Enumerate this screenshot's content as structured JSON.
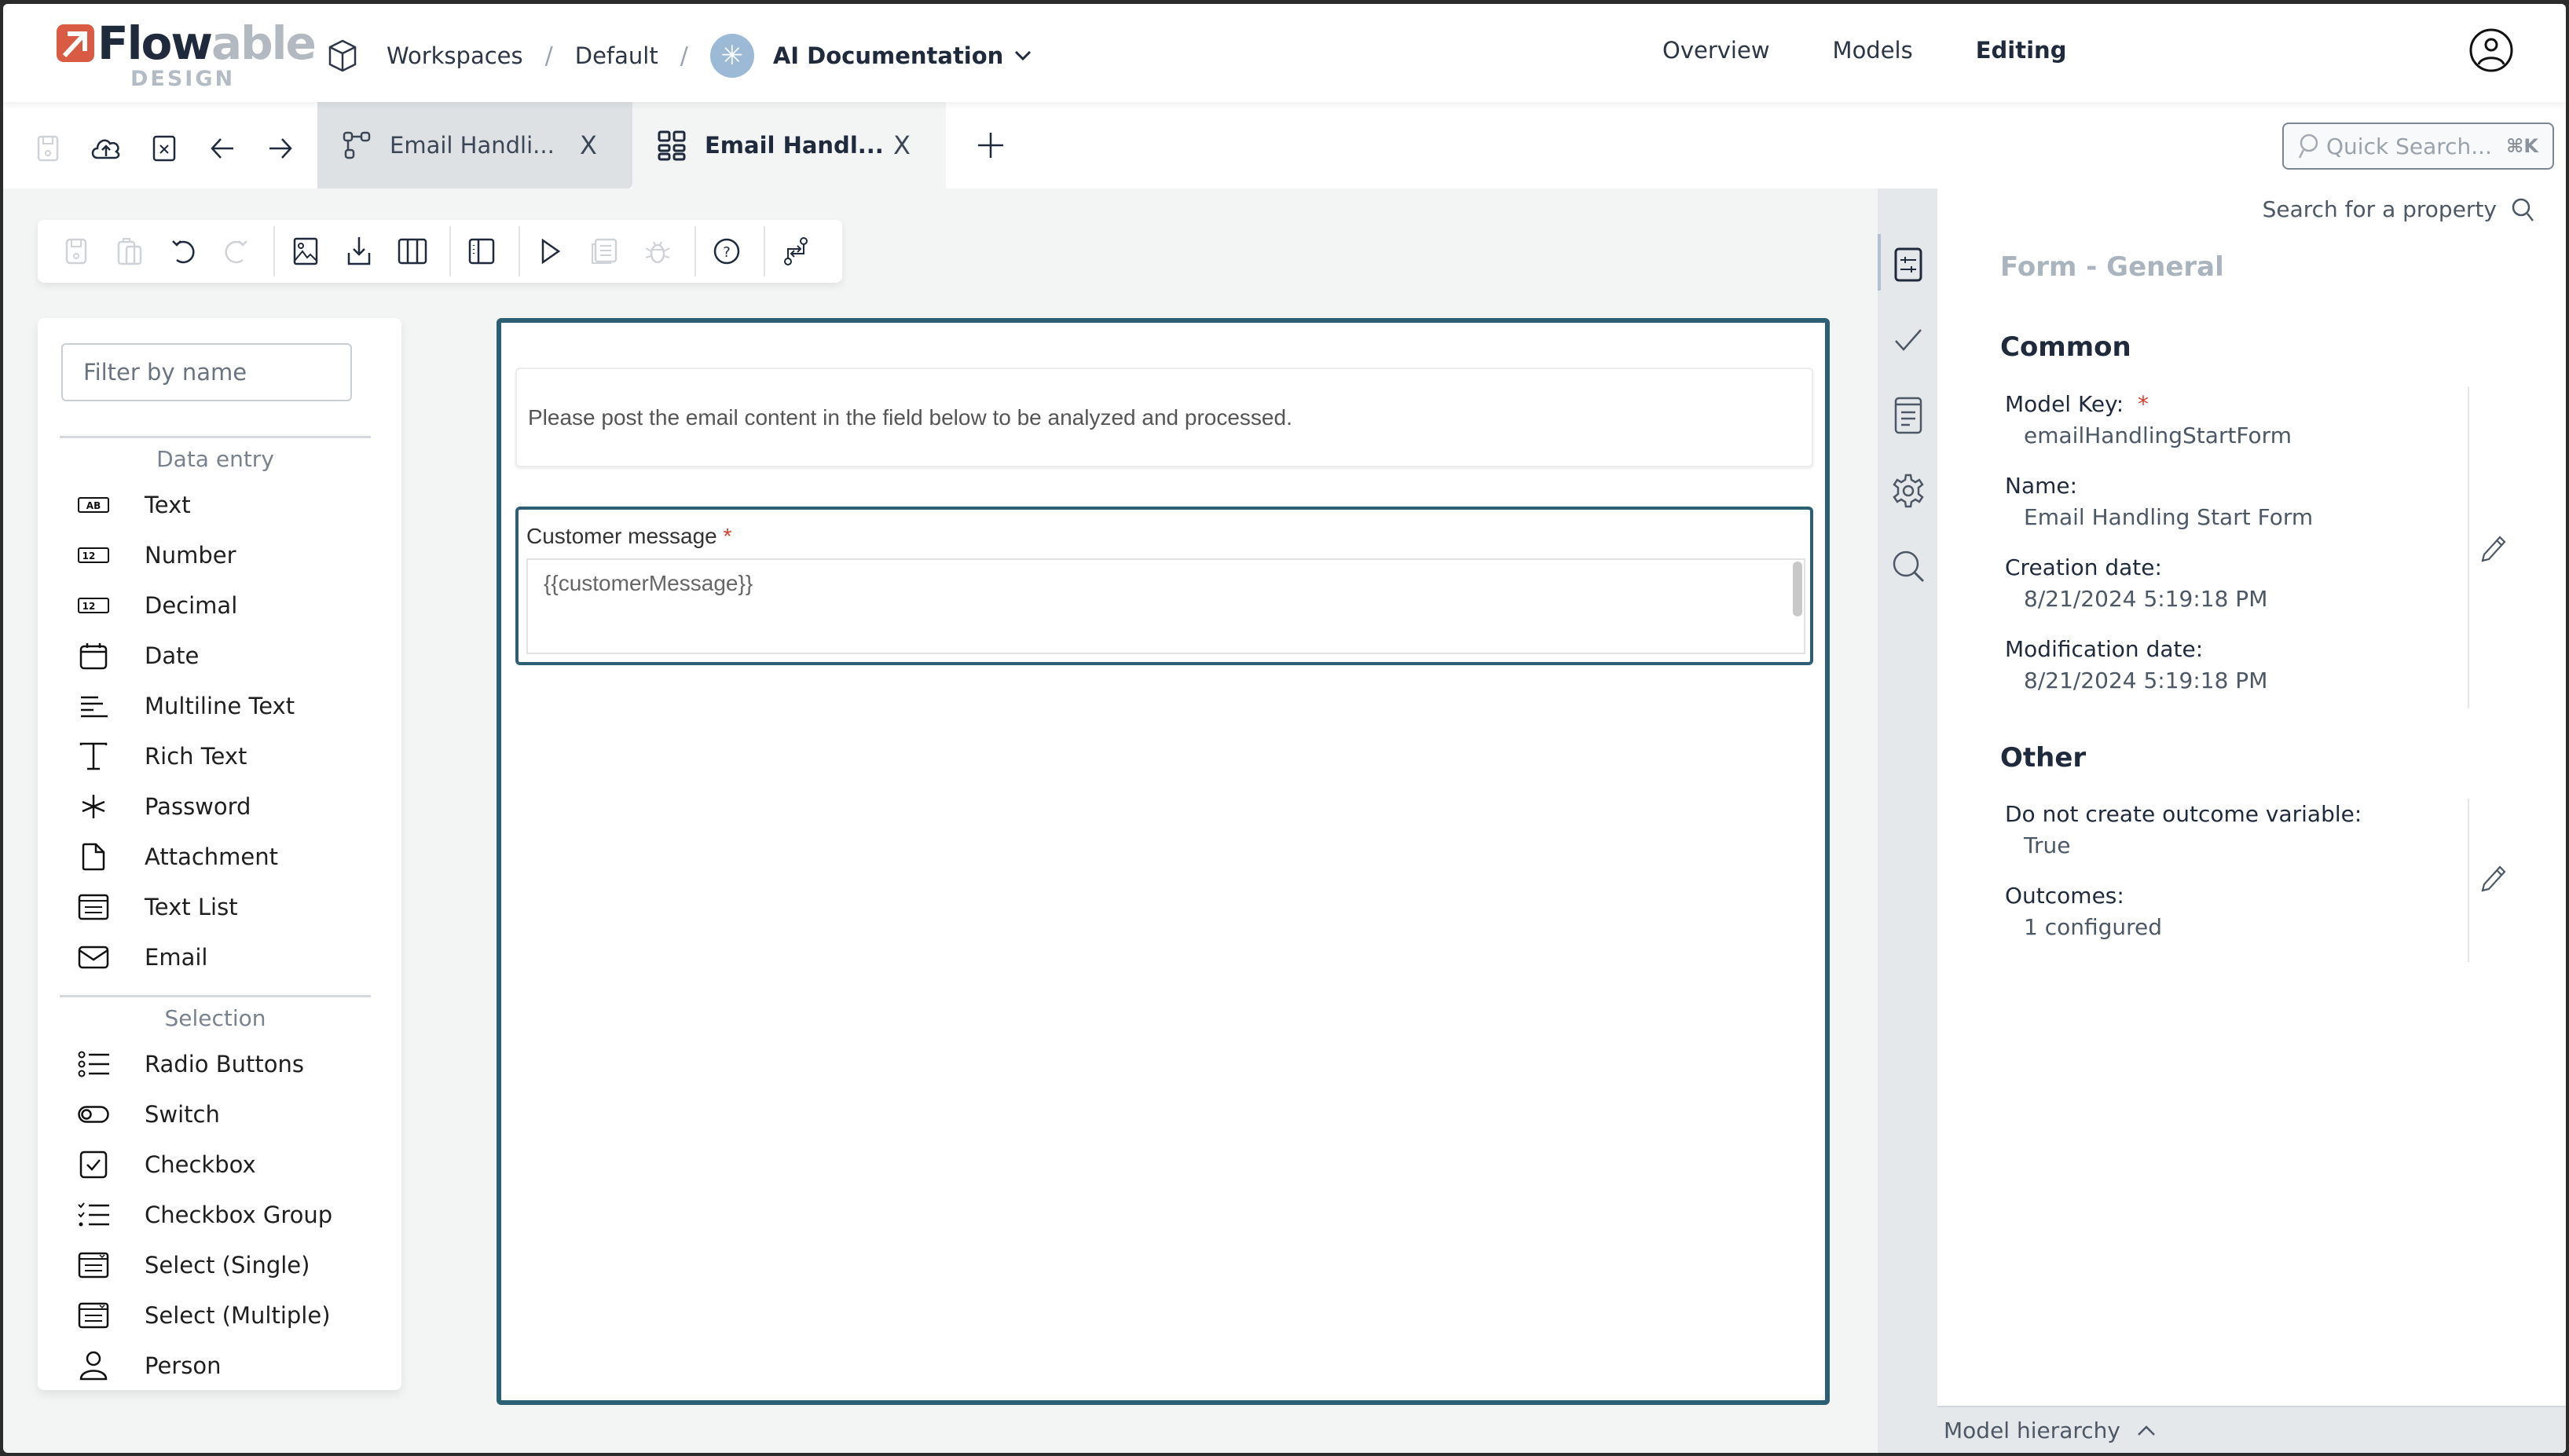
{
  "header": {
    "logo": {
      "brand_dark": "Flow",
      "brand_light": "able",
      "sub": "DESIGN"
    },
    "breadcrumb": [
      {
        "label": "Workspaces",
        "icon": "cube-icon"
      },
      {
        "label": "Default"
      },
      {
        "label": "AI Documentation",
        "icon": "asterisk-icon",
        "dropdown": true
      }
    ],
    "separator": "/",
    "nav": [
      {
        "label": "Overview",
        "active": false
      },
      {
        "label": "Models",
        "active": false
      },
      {
        "label": "Editing",
        "active": true
      }
    ],
    "user_icon": "user-circle-icon"
  },
  "tabbar": {
    "tools": [
      "save-icon",
      "upload-cloud-icon",
      "close-all-icon",
      "arrow-left-icon",
      "arrow-right-icon"
    ],
    "tabs": [
      {
        "label": "Email Handli...",
        "icon": "process-model-icon",
        "active": false,
        "close": "X"
      },
      {
        "label": "Email Handl...",
        "icon": "form-model-icon",
        "active": true,
        "close": "X"
      }
    ],
    "add_tab": "+",
    "quick_search": {
      "placeholder": "Quick Search...",
      "shortcut": "⌘K"
    }
  },
  "toolbar": {
    "buttons": [
      {
        "name": "save",
        "enabled": false
      },
      {
        "name": "paste",
        "enabled": false
      },
      {
        "name": "undo",
        "enabled": true
      },
      {
        "name": "redo",
        "enabled": false
      },
      {
        "name": "image-export",
        "enabled": true
      },
      {
        "name": "download",
        "enabled": true
      },
      {
        "name": "columns",
        "enabled": true
      },
      {
        "name": "side-panel",
        "enabled": true
      },
      {
        "name": "run",
        "enabled": true
      },
      {
        "name": "preview",
        "enabled": false
      },
      {
        "name": "debug",
        "enabled": false
      },
      {
        "name": "help",
        "enabled": true
      },
      {
        "name": "compare",
        "enabled": true
      }
    ]
  },
  "palette": {
    "filter_placeholder": "Filter by name",
    "groups": [
      {
        "title": "Data entry",
        "items": [
          {
            "label": "Text",
            "icon": "text-field-icon"
          },
          {
            "label": "Number",
            "icon": "number-field-icon"
          },
          {
            "label": "Decimal",
            "icon": "decimal-field-icon"
          },
          {
            "label": "Date",
            "icon": "calendar-icon"
          },
          {
            "label": "Multiline Text",
            "icon": "multiline-icon"
          },
          {
            "label": "Rich Text",
            "icon": "rich-text-icon"
          },
          {
            "label": "Password",
            "icon": "asterisk-icon"
          },
          {
            "label": "Attachment",
            "icon": "file-icon"
          },
          {
            "label": "Text List",
            "icon": "text-list-icon"
          },
          {
            "label": "Email",
            "icon": "envelope-icon"
          }
        ]
      },
      {
        "title": "Selection",
        "items": [
          {
            "label": "Radio Buttons",
            "icon": "radio-list-icon"
          },
          {
            "label": "Switch",
            "icon": "toggle-icon"
          },
          {
            "label": "Checkbox",
            "icon": "checkbox-icon"
          },
          {
            "label": "Checkbox Group",
            "icon": "checklist-icon"
          },
          {
            "label": "Select (Single)",
            "icon": "select-single-icon"
          },
          {
            "label": "Select (Multiple)",
            "icon": "select-multiple-icon"
          },
          {
            "label": "Person",
            "icon": "person-icon"
          }
        ]
      }
    ]
  },
  "canvas": {
    "text_block": "Please post the email content in the field below to be analyzed and processed.",
    "field": {
      "label": "Customer message",
      "required_marker": "*",
      "value": "{{customerMessage}}"
    }
  },
  "side_tabs": [
    "properties-sliders-icon",
    "check-icon",
    "document-icon",
    "gear-icon",
    "search-icon"
  ],
  "properties": {
    "search_placeholder": "Search for a property",
    "title": "Form - General",
    "sections": [
      {
        "title": "Common",
        "fields": [
          {
            "label": "Model Key:",
            "required": true,
            "value": "emailHandlingStartForm"
          },
          {
            "label": "Name:",
            "required": false,
            "value": "Email Handling Start Form"
          },
          {
            "label": "Creation date:",
            "required": false,
            "value": "8/21/2024 5:19:18 PM"
          },
          {
            "label": "Modification date:",
            "required": false,
            "value": "8/21/2024 5:19:18 PM"
          }
        ]
      },
      {
        "title": "Other",
        "fields": [
          {
            "label": "Do not create outcome variable:",
            "required": false,
            "value": "True"
          },
          {
            "label": "Outcomes:",
            "required": false,
            "value": "1 configured"
          }
        ]
      }
    ],
    "hierarchy_label": "Model hierarchy"
  },
  "colors": {
    "brand_orange": "#d95b43",
    "brand_dark": "#1f2a3c",
    "selection_border": "#2c5f73",
    "required": "#e03a2a",
    "ai_badge": "#9cb9d6"
  }
}
